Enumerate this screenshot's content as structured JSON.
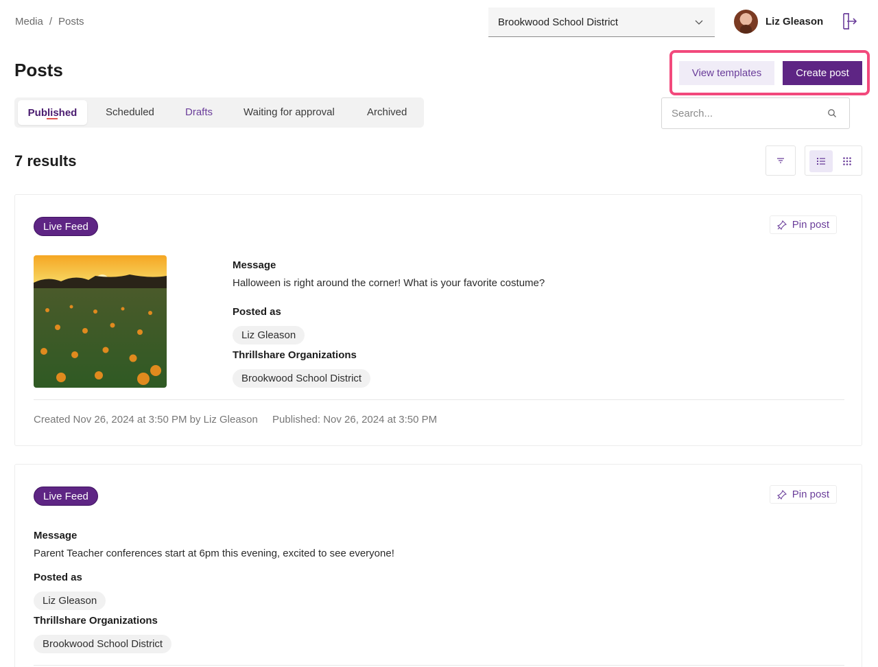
{
  "breadcrumb": {
    "parent": "Media",
    "separator": "/",
    "current": "Posts"
  },
  "district_select": {
    "value": "Brookwood School District"
  },
  "user": {
    "name": "Liz Gleason"
  },
  "page": {
    "title": "Posts"
  },
  "actions": {
    "view_templates": "View templates",
    "create_post": "Create post"
  },
  "tabs": [
    {
      "label": "Published",
      "active": true
    },
    {
      "label": "Scheduled"
    },
    {
      "label": "Drafts"
    },
    {
      "label": "Waiting for approval"
    },
    {
      "label": "Archived"
    }
  ],
  "search": {
    "placeholder": "Search..."
  },
  "results": {
    "count_label": "7 results"
  },
  "posts": [
    {
      "badge": "Live Feed",
      "pin_label": "Pin post",
      "message_label": "Message",
      "message": "Halloween is right around the corner! What is your favorite costume?",
      "posted_as_label": "Posted as",
      "posted_as": "Liz Gleason",
      "orgs_label": "Thrillshare Organizations",
      "org": "Brookwood School District",
      "created": "Created Nov 26, 2024 at 3:50 PM by Liz Gleason",
      "published": "Published: Nov 26, 2024 at 3:50 PM"
    },
    {
      "badge": "Live Feed",
      "pin_label": "Pin post",
      "message_label": "Message",
      "message": "Parent Teacher conferences start at 6pm this evening, excited to see everyone!",
      "posted_as_label": "Posted as",
      "posted_as": "Liz Gleason",
      "orgs_label": "Thrillshare Organizations",
      "org": "Brookwood School District"
    }
  ],
  "colors": {
    "accent": "#5e2584",
    "highlight": "#f2497c",
    "accent_light": "#f0ecf7"
  },
  "icons": [
    "chevron-down-icon",
    "logout-icon",
    "search-icon",
    "filter-icon",
    "list-view-icon",
    "grid-view-icon",
    "pin-icon"
  ]
}
